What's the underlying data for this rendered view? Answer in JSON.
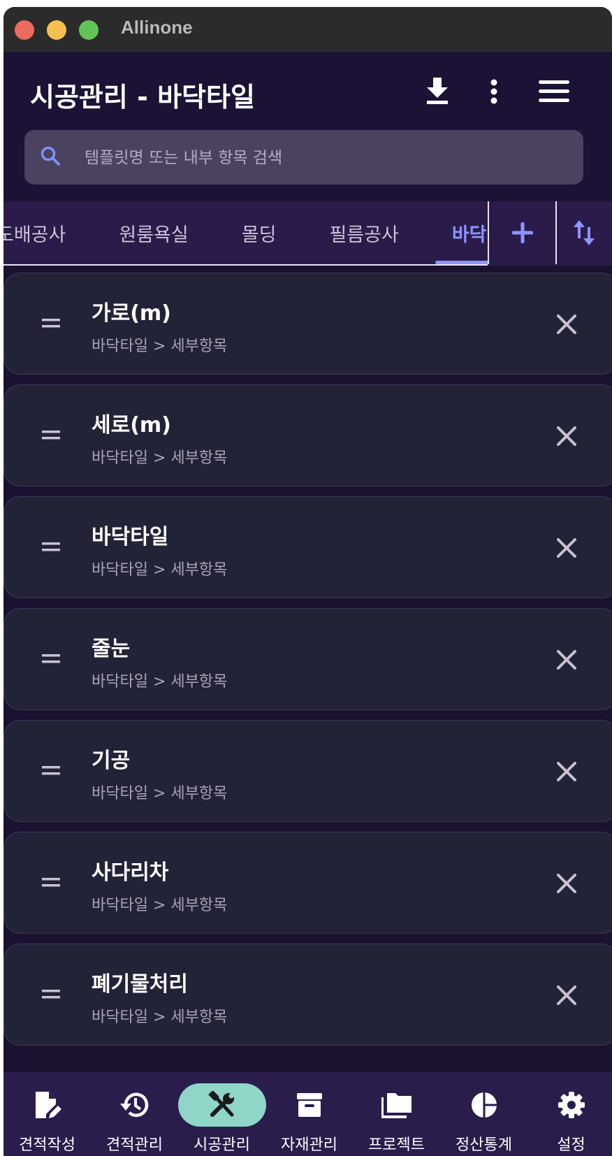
{
  "window": {
    "title": "Allinone"
  },
  "appbar": {
    "title": "시공관리 - 바닥타일"
  },
  "search": {
    "placeholder": "템플릿명 또는 내부 항목 검색"
  },
  "tabs": [
    {
      "label": "도배공사",
      "active": false
    },
    {
      "label": "원룸욕실",
      "active": false
    },
    {
      "label": "몰딩",
      "active": false
    },
    {
      "label": "필름공사",
      "active": false
    },
    {
      "label": "바닥타일",
      "active": true
    }
  ],
  "items": [
    {
      "title": "가로(m)",
      "subtitle": "바닥타일 > 세부항목"
    },
    {
      "title": "세로(m)",
      "subtitle": "바닥타일 > 세부항목"
    },
    {
      "title": "바닥타일",
      "subtitle": "바닥타일 > 세부항목"
    },
    {
      "title": "줄눈",
      "subtitle": "바닥타일 > 세부항목"
    },
    {
      "title": "기공",
      "subtitle": "바닥타일 > 세부항목"
    },
    {
      "title": "사다리차",
      "subtitle": "바닥타일 > 세부항목"
    },
    {
      "title": "폐기물처리",
      "subtitle": "바닥타일 > 세부항목"
    }
  ],
  "nav": [
    {
      "label": "견적작성",
      "icon": "edit-document-icon",
      "active": false
    },
    {
      "label": "견적관리",
      "icon": "history-icon",
      "active": false
    },
    {
      "label": "시공관리",
      "icon": "tools-icon",
      "active": true
    },
    {
      "label": "자재관리",
      "icon": "archive-box-icon",
      "active": false
    },
    {
      "label": "프로젝트",
      "icon": "folders-icon",
      "active": false
    },
    {
      "label": "정산통계",
      "icon": "pie-chart-icon",
      "active": false
    },
    {
      "label": "설정",
      "icon": "gear-icon",
      "active": false
    }
  ],
  "colors": {
    "background": "#1b1230",
    "accent": "#8d95ff",
    "nav_active": "#8fd6c8",
    "card": "#232338"
  }
}
